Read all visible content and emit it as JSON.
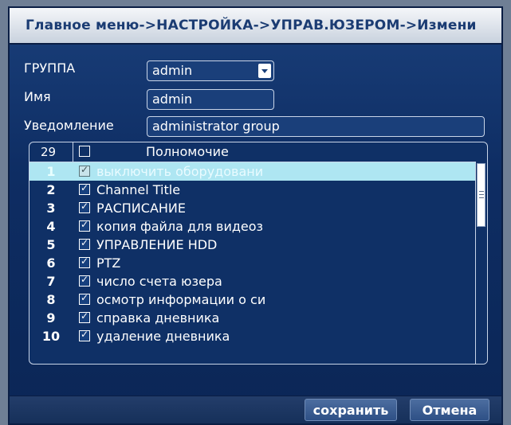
{
  "title": "Главное меню->НАСТРОЙКА->УПРАВ.ЮЗЕРОМ->Измени",
  "form": {
    "group_label": "ГРУППА",
    "group_value": "admin",
    "name_label": "Имя",
    "name_value": "admin",
    "notice_label": "Уведомление",
    "notice_value": "administrator group"
  },
  "permissions": {
    "count": "29",
    "header": "Полномочие",
    "items": [
      {
        "num": "1",
        "label": "выключить оборудовани",
        "checked": true,
        "selected": true
      },
      {
        "num": "2",
        "label": "Channel Title",
        "checked": true,
        "selected": false
      },
      {
        "num": "3",
        "label": "РАСПИСАНИЕ",
        "checked": true,
        "selected": false
      },
      {
        "num": "4",
        "label": "копия файла для видеоз",
        "checked": true,
        "selected": false
      },
      {
        "num": "5",
        "label": "УПРАВЛЕНИЕ HDD",
        "checked": true,
        "selected": false
      },
      {
        "num": "6",
        "label": "PTZ",
        "checked": true,
        "selected": false
      },
      {
        "num": "7",
        "label": "число счета юзера",
        "checked": true,
        "selected": false
      },
      {
        "num": "8",
        "label": "осмотр информации о си",
        "checked": true,
        "selected": false
      },
      {
        "num": "9",
        "label": "справка дневника",
        "checked": true,
        "selected": false
      },
      {
        "num": "10",
        "label": "удаление дневника",
        "checked": true,
        "selected": false
      }
    ]
  },
  "buttons": {
    "save": "сохранить",
    "cancel": "Отмена"
  }
}
